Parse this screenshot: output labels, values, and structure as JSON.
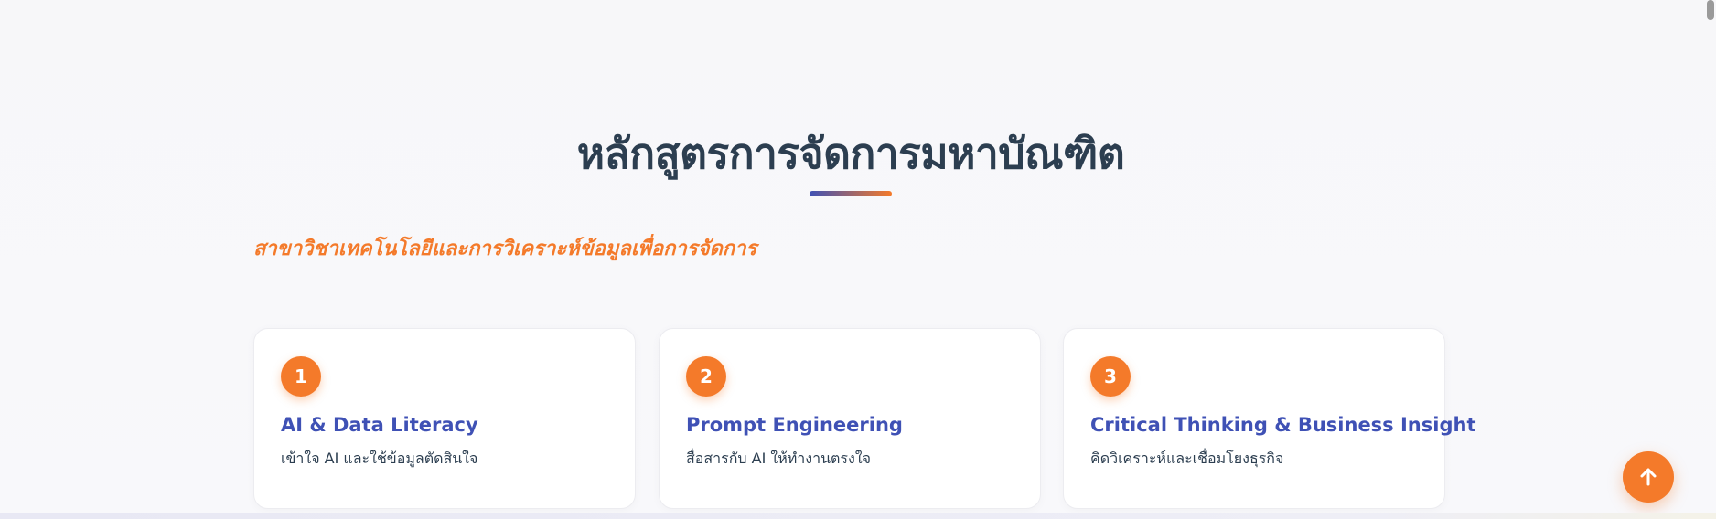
{
  "section": {
    "title": "หลักสูตรการจัดการมหาบัณฑิต",
    "subtitle": "สาขาวิชาเทคโนโลยีและการวิเคราะห์ข้อมูลเพื่อการจัดการ"
  },
  "cards": [
    {
      "number": "1",
      "title": "AI & Data Literacy",
      "description": "เข้าใจ AI และใช้ข้อมูลตัดสินใจ"
    },
    {
      "number": "2",
      "title": "Prompt Engineering",
      "description": "สื่อสารกับ AI ให้ทำงานตรงใจ"
    },
    {
      "number": "3",
      "title": "Critical Thinking & Business Insight",
      "description": "คิดวิเคราะห์และเชื่อมโยงธุรกิจ"
    }
  ],
  "icons": {
    "scroll_top": "arrow-up-icon"
  },
  "colors": {
    "accent_orange": "#f47a2a",
    "accent_blue": "#3f51b5",
    "heading": "#2c3e50"
  }
}
